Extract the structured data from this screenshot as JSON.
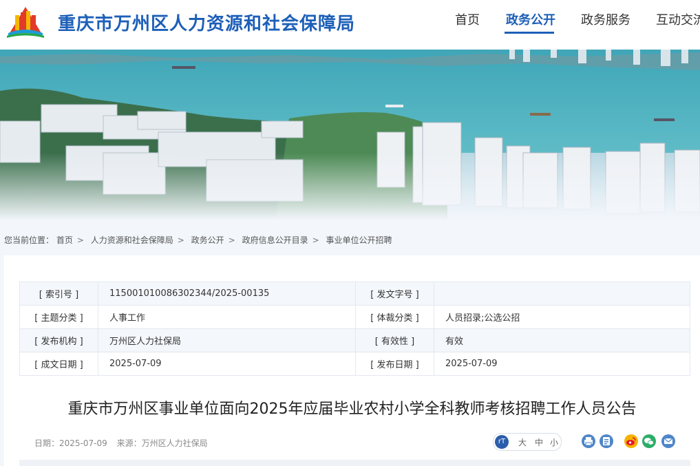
{
  "site": {
    "title": "重庆市万州区人力资源和社会保障局"
  },
  "nav": {
    "items": [
      {
        "label": "首页"
      },
      {
        "label": "政务公开"
      },
      {
        "label": "政务服务"
      },
      {
        "label": "互动交流"
      }
    ],
    "active_index": 1
  },
  "breadcrumb": {
    "prefix": "您当前位置：",
    "items": [
      "首页",
      "人力资源和社会保障局",
      "政务公开",
      "政府信息公开目录",
      "事业单位公开招聘"
    ],
    "separator": ">"
  },
  "info": {
    "index_no_label": "[ 索引号 ]",
    "index_no_value": "115001010086302344/2025-00135",
    "doc_no_label": "[ 发文字号 ]",
    "doc_no_value": "",
    "topic_label": "[ 主题分类 ]",
    "topic_value": "人事工作",
    "genre_label": "[ 体裁分类 ]",
    "genre_value": "人员招录;公选公招",
    "publisher_label": "[ 发布机构 ]",
    "publisher_value": "万州区人力社保局",
    "validity_label": "[ 有效性 ]",
    "validity_value": "有效",
    "created_label": "[ 成文日期 ]",
    "created_value": "2025-07-09",
    "published_label": "[ 发布日期 ]",
    "published_value": "2025-07-09"
  },
  "article": {
    "title": "重庆市万州区事业单位面向2025年应届毕业农村小学全科教师考核招聘工作人员公告",
    "date_text": "日期：2025-07-09",
    "source_text": "来源：万州区人力社保局"
  },
  "font_size": {
    "icon_text": "rT",
    "large": "大",
    "medium": "中",
    "small": "小"
  },
  "tools": {
    "print_icon": "print-icon",
    "doc_icon": "document-icon",
    "weibo_icon": "weibo-icon",
    "wechat_icon": "wechat-icon",
    "email_icon": "email-icon"
  },
  "colors": {
    "brand": "#1d5fb8",
    "weibo": "#e6162d",
    "wechat": "#2aae67"
  }
}
